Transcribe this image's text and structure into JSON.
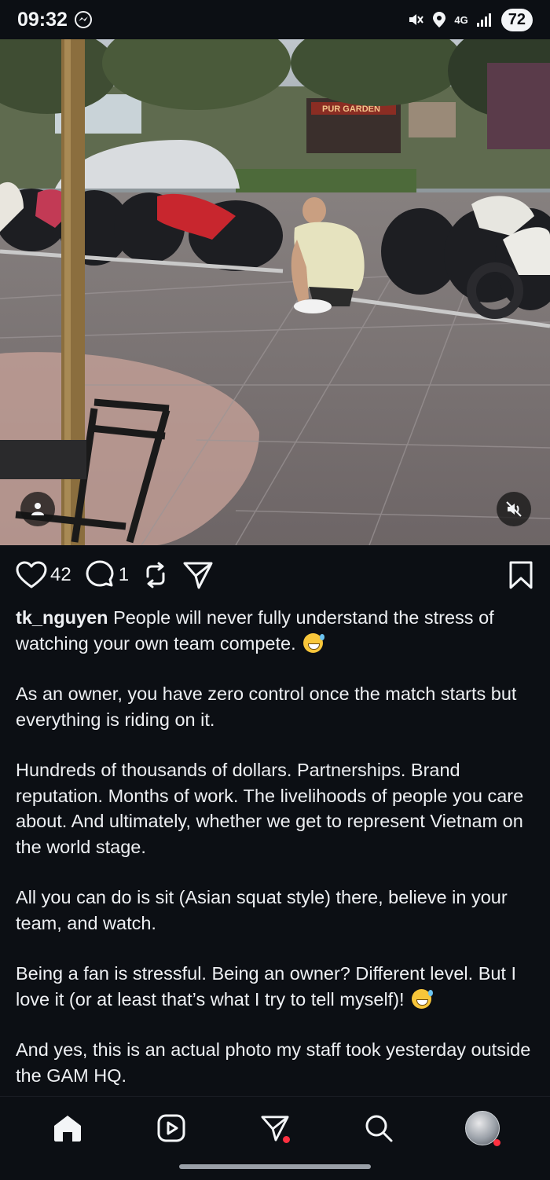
{
  "status_bar": {
    "time": "09:32",
    "network": "4G",
    "battery": "72"
  },
  "post": {
    "likes": "42",
    "comments": "1",
    "username": "tk_nguyen",
    "caption_first": "People will never fully understand the stress of watching your own team compete.",
    "paragraphs": [
      "As an owner, you have zero control once the match starts but everything is riding on it.",
      "Hundreds of thousands of dollars. Partnerships. Brand reputation. Months of work. The livelihoods of people you care about. And ultimately, whether we get to represent Vietnam on the world stage.",
      "All you can do is sit (Asian squat style) there, believe in your team, and watch.",
      "Being a fan is stressful. Being an owner? Different level. But I love it (or at least that’s what I try to tell myself)!",
      "And yes, this is an actual photo my staff took yesterday outside the GAM HQ."
    ],
    "photo_sign_text": "PUR GARDEN"
  },
  "icons": {
    "like": "heart-icon",
    "comment": "comment-icon",
    "repost": "repost-icon",
    "share": "send-icon",
    "save": "bookmark-icon",
    "mute": "muted-icon",
    "tagged": "user-tag-icon"
  },
  "colors": {
    "background": "#0c0f14",
    "text": "#f3f5f7",
    "notification_dot": "#ff3040"
  }
}
